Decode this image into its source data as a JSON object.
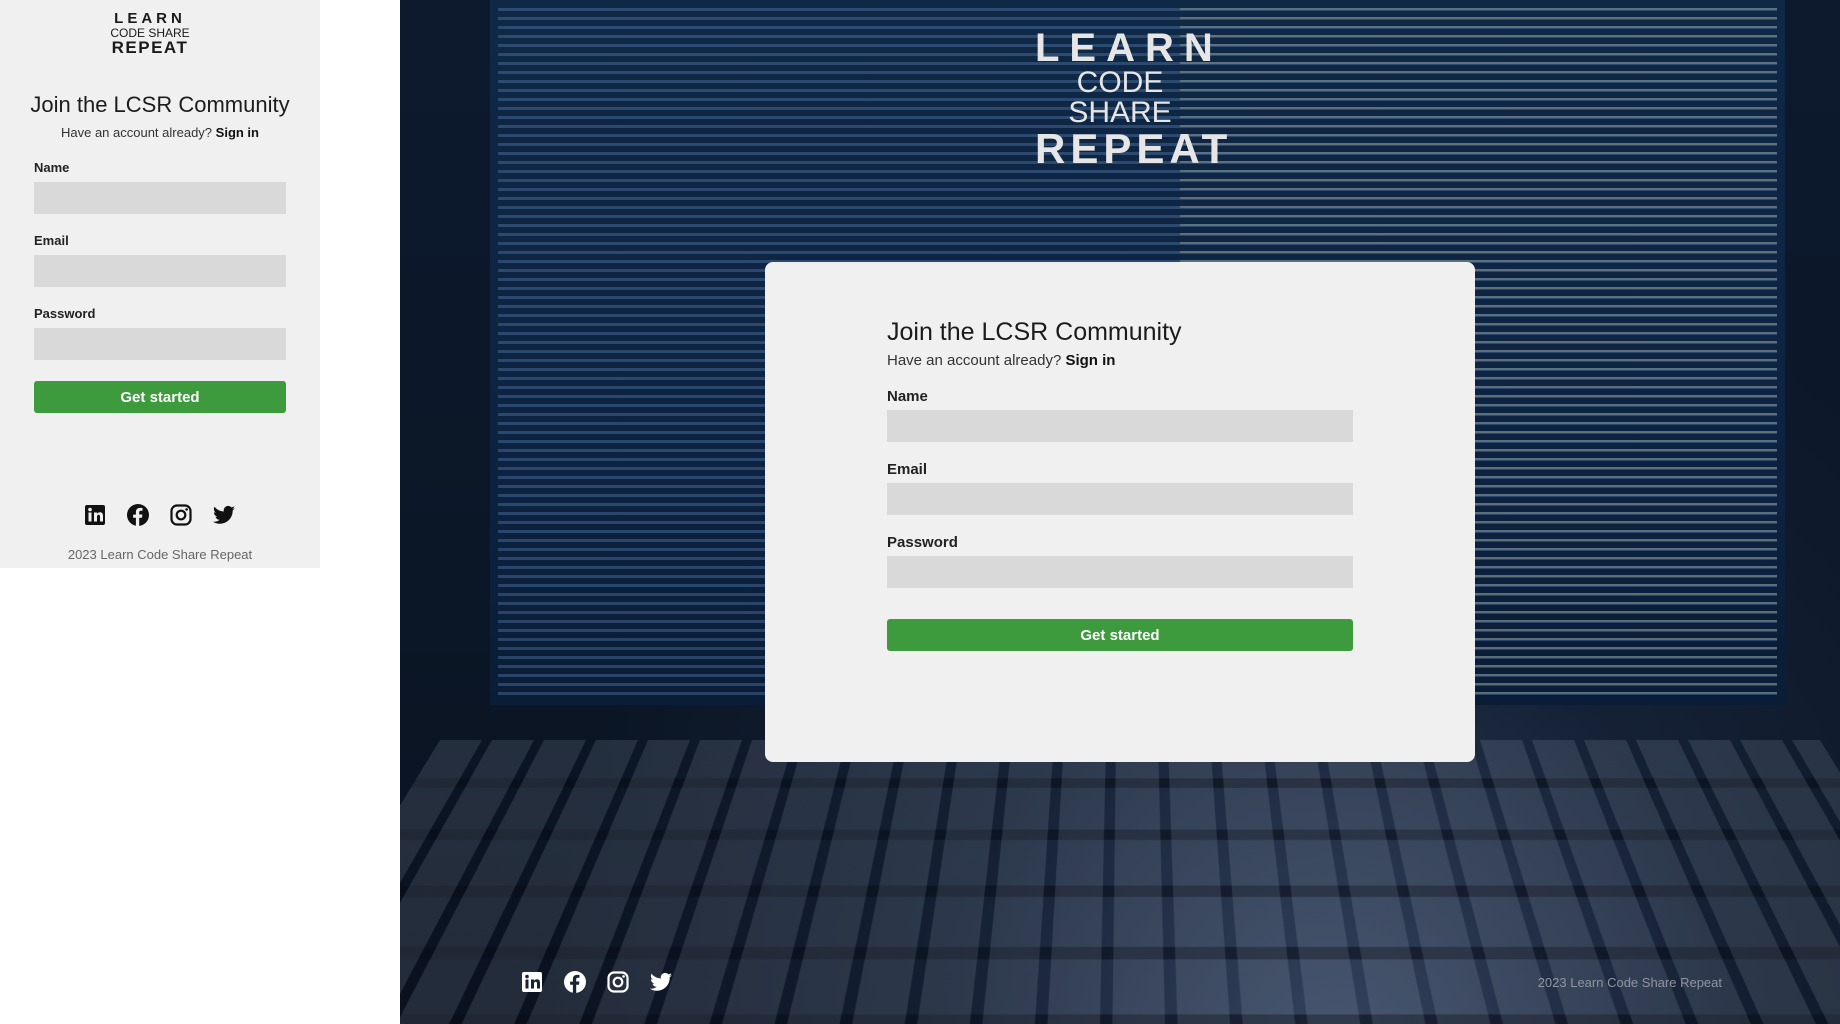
{
  "brand": {
    "line1": "LEARN",
    "line2": "CODE SHARE",
    "line3": "REPEAT"
  },
  "signup": {
    "title": "Join the LCSR Community",
    "account_prompt": "Have an account already?",
    "sign_in_label": "Sign in",
    "fields": {
      "name_label": "Name",
      "email_label": "Email",
      "password_label": "Password"
    },
    "submit_label": "Get started"
  },
  "footer": {
    "copyright": "2023 Learn Code Share Repeat",
    "social_icons": [
      "linkedin-icon",
      "facebook-icon",
      "instagram-icon",
      "twitter-icon"
    ]
  },
  "colors": {
    "primary_button": "#3d9a3d",
    "panel_bg": "#f0f0f0",
    "input_bg": "#d9d9d9"
  }
}
